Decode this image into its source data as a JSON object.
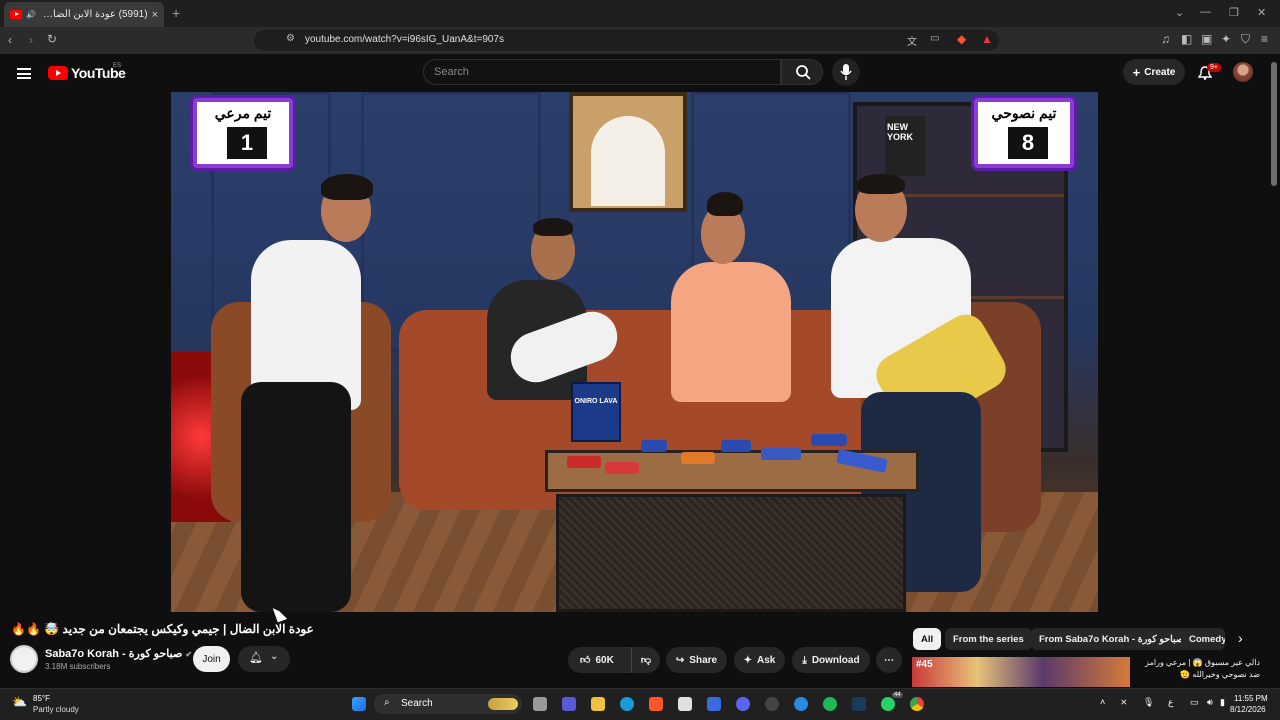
{
  "browser": {
    "tab_title": "(5991) عودة الابن الضال | جيمي...",
    "tab_close": "×",
    "new_tab": "+",
    "url": "youtube.com/watch?v=i96sIG_UanA&t=907s"
  },
  "yt_header": {
    "logo_text": "YouTube",
    "country_code": "ES",
    "search_placeholder": "Search",
    "create_label": "Create",
    "notification_count": "9+"
  },
  "video": {
    "title": "عودة الابن الضال | جيمي وكيكس يجتمعان من جديد 🤯 🔥🔥",
    "scoreboard_left": {
      "title": "تيم مرعي",
      "score": "1"
    },
    "scoreboard_right": {
      "title": "تيم نصوحي",
      "score": "8"
    },
    "product_label": "ONIRO LAVA"
  },
  "channel": {
    "name": "Saba7o Korah - صباحو كورة",
    "subscribers": "3.18M subscribers",
    "join_label": "Join"
  },
  "actions": {
    "likes": "60K",
    "share": "Share",
    "ask": "Ask",
    "download": "Download"
  },
  "sidebar": {
    "chips": [
      "All",
      "From the series",
      "From Saba7o Korah - صباحو كورة",
      "Comedy"
    ],
    "thumb_badge": "#45",
    "rec_title": "دالي عير مسبوق 😱 | مرعي ورامز ضد نصوحي وخيرالله 🫡"
  },
  "taskbar": {
    "weather_temp": "85°F",
    "weather_desc": "Partly cloudy",
    "search_label": "Search",
    "time": "11:55 PM",
    "date": "8/12/2026",
    "whatsapp_badge": "44"
  },
  "colors": {
    "yt_red": "#ff0000",
    "bg": "#0f0f0f",
    "pill": "#272727",
    "score_frame": "#8a3dd6"
  }
}
